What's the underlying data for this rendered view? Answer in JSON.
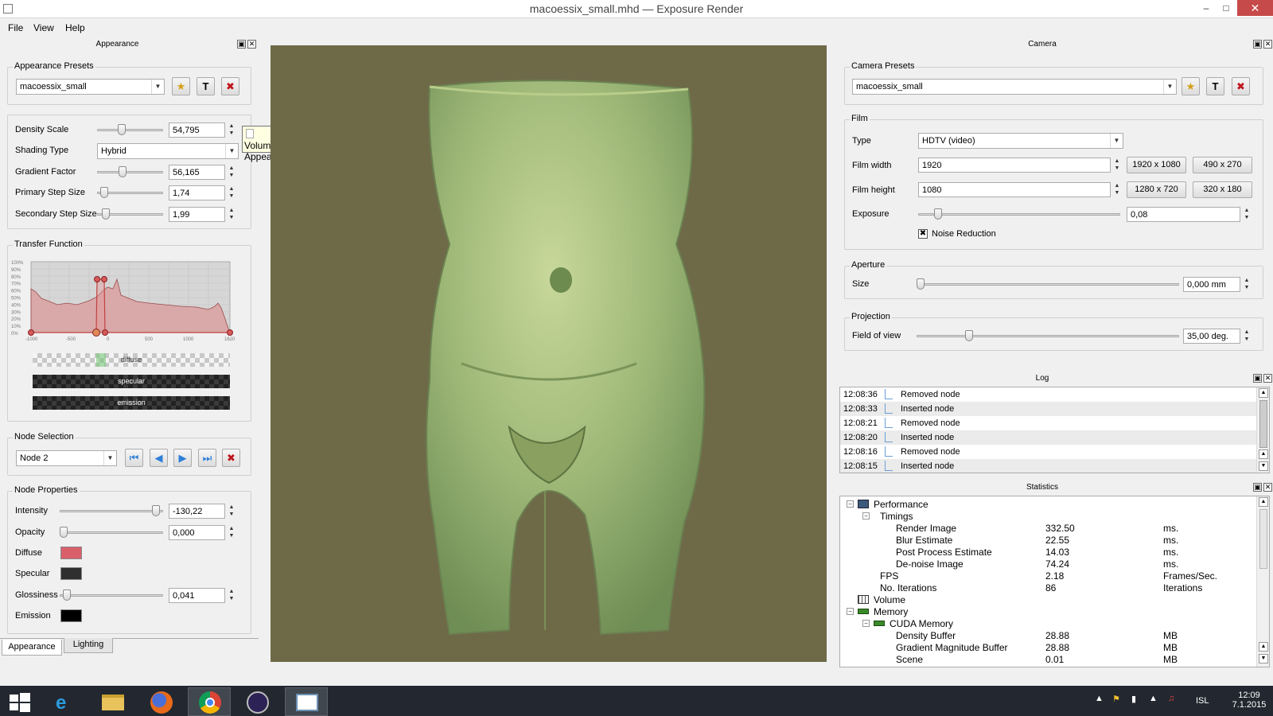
{
  "window": {
    "title": "macoessix_small.mhd — Exposure Render",
    "minimize": "–",
    "maximize": "□",
    "close": "✕"
  },
  "menu": {
    "file": "File",
    "view": "View",
    "help": "Help"
  },
  "appearance_dock": {
    "title": "Appearance",
    "presets": {
      "title": "Appearance Presets",
      "value": "macoessix_small"
    },
    "density_scale": {
      "label": "Density Scale",
      "value": "54,795",
      "level": 0.36
    },
    "shading_type": {
      "label": "Shading Type",
      "value": "Hybrid"
    },
    "gradient_factor": {
      "label": "Gradient Factor",
      "value": "56,165",
      "level": 0.37
    },
    "primary_step": {
      "label": "Primary Step Size",
      "value": "1,74",
      "level": 0.05
    },
    "secondary_step": {
      "label": "Secondary Step Size",
      "value": "1,99",
      "level": 0.08
    },
    "tooltip": "Volume Appearance",
    "transfer_function": {
      "title": "Transfer Function",
      "y_ticks": [
        "100%",
        "90%",
        "80%",
        "70%",
        "60%",
        "50%",
        "40%",
        "30%",
        "20%",
        "10%",
        "0%"
      ],
      "x_ticks": [
        "-1000",
        "-500",
        "0",
        "500",
        "1000",
        "1620"
      ],
      "bars": {
        "diffuse": "diffuse",
        "specular": "specular",
        "emission": "emission"
      }
    },
    "node_selection": {
      "title": "Node Selection",
      "value": "Node 2"
    },
    "node_properties": {
      "title": "Node Properties",
      "intensity": {
        "label": "Intensity",
        "value": "-130,22",
        "level": 0.97
      },
      "opacity": {
        "label": "Opacity",
        "value": "0,000",
        "level": 0.0
      },
      "diffuse": {
        "label": "Diffuse",
        "color": "#d95f6b"
      },
      "specular": {
        "label": "Specular",
        "color": "#2f2f2f"
      },
      "glossiness": {
        "label": "Glossiness",
        "value": "0,041",
        "level": 0.03
      },
      "emission": {
        "label": "Emission",
        "color": "#000000"
      }
    },
    "tabs": {
      "appearance": "Appearance",
      "lighting": "Lighting"
    }
  },
  "camera_dock": {
    "title": "Camera",
    "presets": {
      "title": "Camera Presets",
      "value": "macoessix_small"
    },
    "film": {
      "title": "Film",
      "type": {
        "label": "Type",
        "value": "HDTV (video)"
      },
      "width": {
        "label": "Film width",
        "value": "1920"
      },
      "height": {
        "label": "Film height",
        "value": "1080"
      },
      "presets": [
        "1920 x 1080",
        "490 x 270",
        "1280 x 720",
        "320 x 180"
      ],
      "exposure": {
        "label": "Exposure",
        "value": "0,08",
        "level": 0.08
      },
      "noise_reduction": {
        "label": "Noise Reduction",
        "checked": true
      }
    },
    "aperture": {
      "title": "Aperture",
      "size": {
        "label": "Size",
        "value": "0,000 mm",
        "level": 0.0
      }
    },
    "projection": {
      "title": "Projection",
      "fov": {
        "label": "Field of view",
        "value": "35,00 deg.",
        "level": 0.19
      }
    }
  },
  "log_dock": {
    "title": "Log",
    "rows": [
      {
        "time": "12:08:36",
        "msg": "Removed node"
      },
      {
        "time": "12:08:33",
        "msg": "Inserted node"
      },
      {
        "time": "12:08:21",
        "msg": "Removed node"
      },
      {
        "time": "12:08:20",
        "msg": "Inserted node"
      },
      {
        "time": "12:08:16",
        "msg": "Removed node"
      },
      {
        "time": "12:08:15",
        "msg": "Inserted node"
      }
    ]
  },
  "statistics_dock": {
    "title": "Statistics",
    "rows": [
      {
        "level": 0,
        "expand": "−",
        "icon": "perf",
        "key": "Performance",
        "value": "",
        "unit": ""
      },
      {
        "level": 1,
        "expand": "−",
        "icon": "",
        "key": "Timings",
        "value": "",
        "unit": ""
      },
      {
        "level": 2,
        "expand": "",
        "icon": "",
        "key": "Render Image",
        "value": "332.50",
        "unit": "ms."
      },
      {
        "level": 2,
        "expand": "",
        "icon": "",
        "key": "Blur Estimate",
        "value": "22.55",
        "unit": "ms."
      },
      {
        "level": 2,
        "expand": "",
        "icon": "",
        "key": "Post Process Estimate",
        "value": "14.03",
        "unit": "ms."
      },
      {
        "level": 2,
        "expand": "",
        "icon": "",
        "key": "De-noise Image",
        "value": "74.24",
        "unit": "ms."
      },
      {
        "level": 1,
        "expand": "",
        "icon": "",
        "key": "FPS",
        "value": "2.18",
        "unit": "Frames/Sec."
      },
      {
        "level": 1,
        "expand": "",
        "icon": "",
        "key": "No. Iterations",
        "value": "86",
        "unit": "Iterations"
      },
      {
        "level": 0,
        "expand": "",
        "icon": "grid",
        "key": "Volume",
        "value": "",
        "unit": ""
      },
      {
        "level": 0,
        "expand": "−",
        "icon": "mem",
        "key": "Memory",
        "value": "",
        "unit": ""
      },
      {
        "level": 1,
        "expand": "−",
        "icon": "mem",
        "key": "CUDA Memory",
        "value": "",
        "unit": ""
      },
      {
        "level": 2,
        "expand": "",
        "icon": "",
        "key": "Density Buffer",
        "value": "28.88",
        "unit": "MB"
      },
      {
        "level": 2,
        "expand": "",
        "icon": "",
        "key": "Gradient Magnitude Buffer",
        "value": "28.88",
        "unit": "MB"
      },
      {
        "level": 2,
        "expand": "",
        "icon": "",
        "key": "Scene",
        "value": "0.01",
        "unit": "MB"
      }
    ]
  },
  "taskbar": {
    "time": "12:09",
    "date": "7.1.2015",
    "lang": "ISL"
  }
}
